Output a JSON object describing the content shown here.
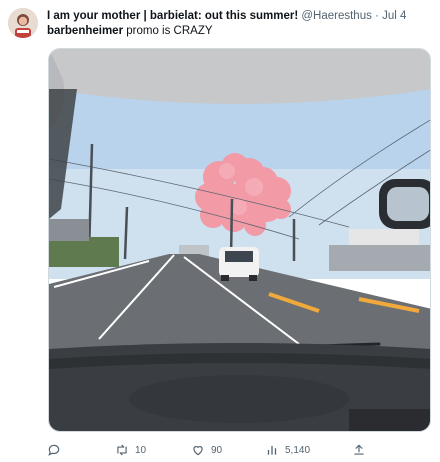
{
  "tweet": {
    "display_name": "I am your mother | barbielat: out this summer!",
    "handle": "@Haeresthus",
    "separator": "·",
    "date": "Jul 4",
    "text_link": "barbenheimer",
    "text_rest": " promo is CRAZY"
  },
  "actions": {
    "reply_icon": "reply-icon",
    "retweet_icon": "retweet-icon",
    "retweet_count": "10",
    "like_icon": "heart-icon",
    "like_count": "90",
    "views_icon": "views-icon",
    "views_count": "5,140",
    "share_icon": "share-icon"
  },
  "colors": {
    "text": "#0f1419",
    "secondary": "#536471",
    "border": "#cfd9de",
    "smoke": "#f29aa6"
  }
}
